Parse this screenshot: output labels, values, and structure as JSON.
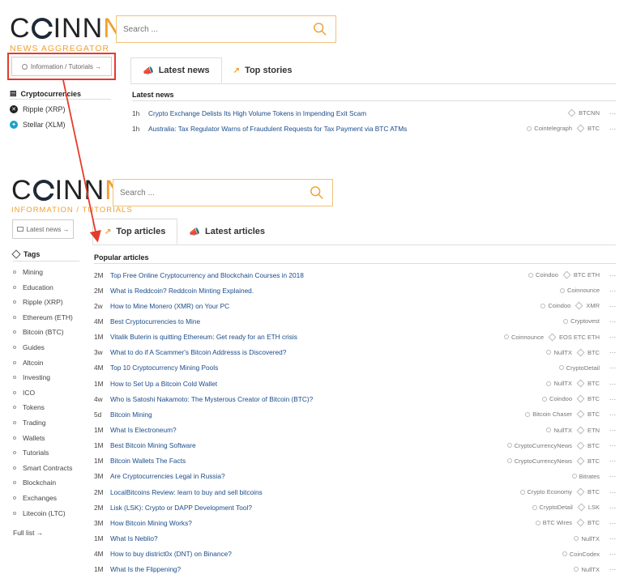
{
  "top": {
    "logo": {
      "part1": "C",
      "part2": "INN",
      "part3": "NA",
      "sub": "NEWS AGGREGATOR"
    },
    "search_placeholder": "Search ...",
    "info_button": "Information / Tutorials →",
    "tabs": [
      {
        "label": "Latest news"
      },
      {
        "label": "Top stories"
      }
    ],
    "section_title": "Latest news",
    "categories_heading": "Cryptocurrencies",
    "categories": [
      {
        "label": "Ripple (XRP)"
      },
      {
        "label": "Stellar (XLM)"
      }
    ],
    "news": [
      {
        "age": "1h",
        "title": "Crypto Exchange Delists Its High Volume Tokens in Impending Exit Scam",
        "source": "",
        "tags": "BTCNN"
      },
      {
        "age": "1h",
        "title": "Australia: Tax Regulator Warns of Fraudulent Requests for Tax Payment via BTC ATMs",
        "source": "Cointelegraph",
        "tags": "BTC"
      }
    ]
  },
  "bottom": {
    "logo": {
      "part1": "C",
      "part2": "INN",
      "part3": "NA",
      "sub": "INFORMATION / TUTORIALS"
    },
    "search_placeholder": "Search ...",
    "latest_news_button": "Latest news →",
    "tabs": [
      {
        "label": "Top articles"
      },
      {
        "label": "Latest articles"
      }
    ],
    "section_title": "Popular articles",
    "tags_heading": "Tags",
    "tags": [
      {
        "label": "Mining"
      },
      {
        "label": "Education"
      },
      {
        "label": "Ripple (XRP)"
      },
      {
        "label": "Ethereum (ETH)"
      },
      {
        "label": "Bitcoin (BTC)"
      },
      {
        "label": "Guides"
      },
      {
        "label": "Altcoin"
      },
      {
        "label": "Investing"
      },
      {
        "label": "ICO"
      },
      {
        "label": "Tokens"
      },
      {
        "label": "Trading"
      },
      {
        "label": "Wallets"
      },
      {
        "label": "Tutorials"
      },
      {
        "label": "Smart Contracts"
      },
      {
        "label": "Blockchain"
      },
      {
        "label": "Exchanges"
      },
      {
        "label": "Litecoin (LTC)"
      }
    ],
    "full_list": "Full list →",
    "articles": [
      {
        "age": "2M",
        "title": "Top Free Online Cryptocurrency and Blockchain Courses in 2018",
        "source": "Coindoo",
        "tags": "BTC ETH"
      },
      {
        "age": "2M",
        "title": "What is Reddcoin? Reddcoin Minting Explained.",
        "source": "Coinnounce",
        "tags": ""
      },
      {
        "age": "2w",
        "title": "How to Mine Monero (XMR) on Your PC",
        "source": "Coindoo",
        "tags": "XMR"
      },
      {
        "age": "4M",
        "title": "Best Cryptocurrencies to Mine",
        "source": "Cryptovest",
        "tags": ""
      },
      {
        "age": "1M",
        "title": "Vitalik Buterin is quitting Ethereum: Get ready for an ETH crisis",
        "source": "Coinnounce",
        "tags": "EOS ETC ETH"
      },
      {
        "age": "3w",
        "title": "What to do if A Scammer's Bitcoin Addresss is Discovered?",
        "source": "NullTX",
        "tags": "BTC"
      },
      {
        "age": "4M",
        "title": "Top 10 Cryptocurrency Mining Pools",
        "source": "CryptoDetail",
        "tags": ""
      },
      {
        "age": "1M",
        "title": "How to Set Up a Bitcoin Cold Wallet",
        "source": "NullTX",
        "tags": "BTC"
      },
      {
        "age": "4w",
        "title": "Who is Satoshi Nakamoto: The Mysterous Creator of Bitcoin (BTC)?",
        "source": "Coindoo",
        "tags": "BTC"
      },
      {
        "age": "5d",
        "title": "Bitcoin Mining",
        "source": "Bitcoin Chaser",
        "tags": "BTC"
      },
      {
        "age": "1M",
        "title": "What Is Electroneum?",
        "source": "NullTX",
        "tags": "ETN"
      },
      {
        "age": "1M",
        "title": "Best Bitcoin Mining Software",
        "source": "CryptoCurrencyNews",
        "tags": "BTC"
      },
      {
        "age": "1M",
        "title": "Bitcoin Wallets The Facts",
        "source": "CryptoCurrencyNews",
        "tags": "BTC"
      },
      {
        "age": "3M",
        "title": "Are Cryptocurrencies Legal in Russia?",
        "source": "Bitrates",
        "tags": ""
      },
      {
        "age": "2M",
        "title": "LocalBitcoins Review: learn to buy and sell bitcoins",
        "source": "Crypto Economy",
        "tags": "BTC"
      },
      {
        "age": "2M",
        "title": "Lisk (LSK): Crypto or DAPP Development Tool?",
        "source": "CryptoDetail",
        "tags": "LSK"
      },
      {
        "age": "3M",
        "title": "How Bitcoin Mining Works?",
        "source": "BTC Wires",
        "tags": "BTC"
      },
      {
        "age": "1M",
        "title": "What Is Neblio?",
        "source": "NullTX",
        "tags": ""
      },
      {
        "age": "4M",
        "title": "How to buy district0x (DNT) on Binance?",
        "source": "CoinCodex",
        "tags": ""
      },
      {
        "age": "1M",
        "title": "What Is the Flippening?",
        "source": "NullTX",
        "tags": ""
      }
    ]
  },
  "colors": {
    "accent": "#f0a030",
    "link": "#1a4c8b",
    "highlight": "#e53b2c"
  }
}
